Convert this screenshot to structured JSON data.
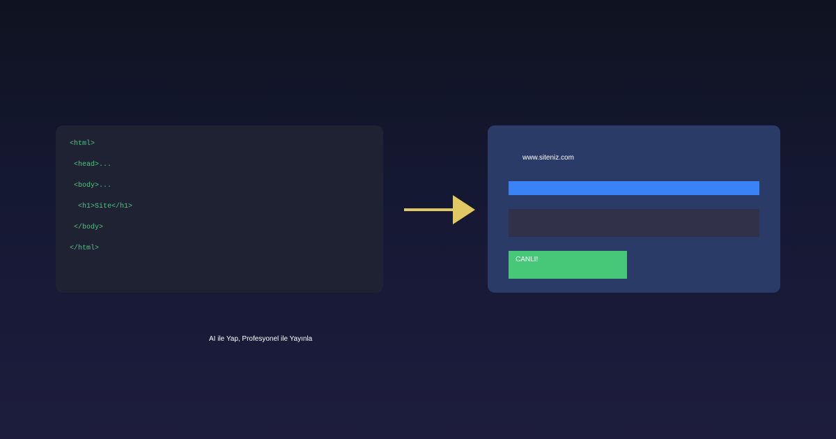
{
  "code_panel": {
    "lines": [
      "<html>",
      " <head>...",
      " <body>...",
      "  <h1>Site</h1>",
      " </body>",
      "</html>"
    ]
  },
  "arrow": {
    "icon": "arrow-right-icon",
    "color": "#e0c865"
  },
  "preview": {
    "url": "www.siteniz.com",
    "live_label": "CANLI!"
  },
  "colors": {
    "code_text": "#4ec57f",
    "preview_panel": "#2a3b67",
    "blue_bar": "#3b82f6",
    "live_button": "#46c878"
  },
  "tagline": "AI ile Yap, Profesyonel ile Yayınla"
}
